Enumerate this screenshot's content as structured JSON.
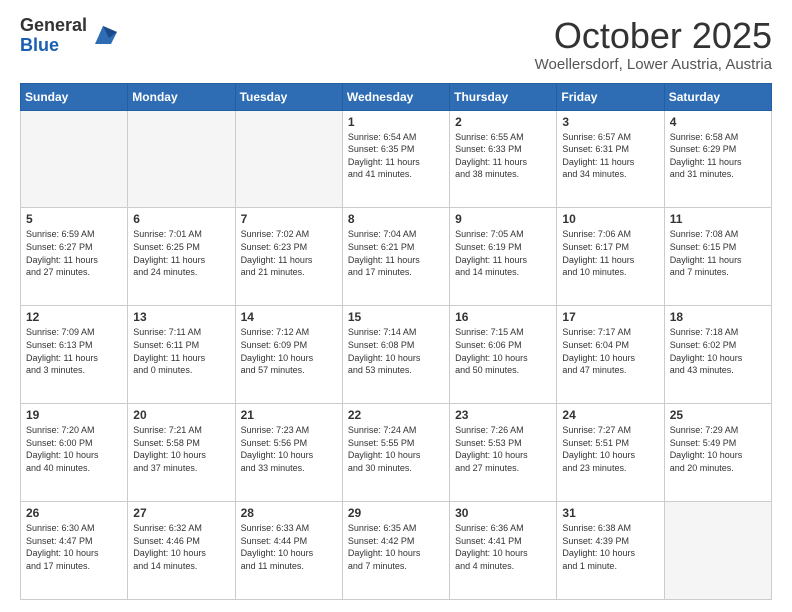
{
  "header": {
    "logo_general": "General",
    "logo_blue": "Blue",
    "month": "October 2025",
    "location": "Woellersdorf, Lower Austria, Austria"
  },
  "weekdays": [
    "Sunday",
    "Monday",
    "Tuesday",
    "Wednesday",
    "Thursday",
    "Friday",
    "Saturday"
  ],
  "weeks": [
    [
      {
        "day": "",
        "info": ""
      },
      {
        "day": "",
        "info": ""
      },
      {
        "day": "",
        "info": ""
      },
      {
        "day": "1",
        "info": "Sunrise: 6:54 AM\nSunset: 6:35 PM\nDaylight: 11 hours\nand 41 minutes."
      },
      {
        "day": "2",
        "info": "Sunrise: 6:55 AM\nSunset: 6:33 PM\nDaylight: 11 hours\nand 38 minutes."
      },
      {
        "day": "3",
        "info": "Sunrise: 6:57 AM\nSunset: 6:31 PM\nDaylight: 11 hours\nand 34 minutes."
      },
      {
        "day": "4",
        "info": "Sunrise: 6:58 AM\nSunset: 6:29 PM\nDaylight: 11 hours\nand 31 minutes."
      }
    ],
    [
      {
        "day": "5",
        "info": "Sunrise: 6:59 AM\nSunset: 6:27 PM\nDaylight: 11 hours\nand 27 minutes."
      },
      {
        "day": "6",
        "info": "Sunrise: 7:01 AM\nSunset: 6:25 PM\nDaylight: 11 hours\nand 24 minutes."
      },
      {
        "day": "7",
        "info": "Sunrise: 7:02 AM\nSunset: 6:23 PM\nDaylight: 11 hours\nand 21 minutes."
      },
      {
        "day": "8",
        "info": "Sunrise: 7:04 AM\nSunset: 6:21 PM\nDaylight: 11 hours\nand 17 minutes."
      },
      {
        "day": "9",
        "info": "Sunrise: 7:05 AM\nSunset: 6:19 PM\nDaylight: 11 hours\nand 14 minutes."
      },
      {
        "day": "10",
        "info": "Sunrise: 7:06 AM\nSunset: 6:17 PM\nDaylight: 11 hours\nand 10 minutes."
      },
      {
        "day": "11",
        "info": "Sunrise: 7:08 AM\nSunset: 6:15 PM\nDaylight: 11 hours\nand 7 minutes."
      }
    ],
    [
      {
        "day": "12",
        "info": "Sunrise: 7:09 AM\nSunset: 6:13 PM\nDaylight: 11 hours\nand 3 minutes."
      },
      {
        "day": "13",
        "info": "Sunrise: 7:11 AM\nSunset: 6:11 PM\nDaylight: 11 hours\nand 0 minutes."
      },
      {
        "day": "14",
        "info": "Sunrise: 7:12 AM\nSunset: 6:09 PM\nDaylight: 10 hours\nand 57 minutes."
      },
      {
        "day": "15",
        "info": "Sunrise: 7:14 AM\nSunset: 6:08 PM\nDaylight: 10 hours\nand 53 minutes."
      },
      {
        "day": "16",
        "info": "Sunrise: 7:15 AM\nSunset: 6:06 PM\nDaylight: 10 hours\nand 50 minutes."
      },
      {
        "day": "17",
        "info": "Sunrise: 7:17 AM\nSunset: 6:04 PM\nDaylight: 10 hours\nand 47 minutes."
      },
      {
        "day": "18",
        "info": "Sunrise: 7:18 AM\nSunset: 6:02 PM\nDaylight: 10 hours\nand 43 minutes."
      }
    ],
    [
      {
        "day": "19",
        "info": "Sunrise: 7:20 AM\nSunset: 6:00 PM\nDaylight: 10 hours\nand 40 minutes."
      },
      {
        "day": "20",
        "info": "Sunrise: 7:21 AM\nSunset: 5:58 PM\nDaylight: 10 hours\nand 37 minutes."
      },
      {
        "day": "21",
        "info": "Sunrise: 7:23 AM\nSunset: 5:56 PM\nDaylight: 10 hours\nand 33 minutes."
      },
      {
        "day": "22",
        "info": "Sunrise: 7:24 AM\nSunset: 5:55 PM\nDaylight: 10 hours\nand 30 minutes."
      },
      {
        "day": "23",
        "info": "Sunrise: 7:26 AM\nSunset: 5:53 PM\nDaylight: 10 hours\nand 27 minutes."
      },
      {
        "day": "24",
        "info": "Sunrise: 7:27 AM\nSunset: 5:51 PM\nDaylight: 10 hours\nand 23 minutes."
      },
      {
        "day": "25",
        "info": "Sunrise: 7:29 AM\nSunset: 5:49 PM\nDaylight: 10 hours\nand 20 minutes."
      }
    ],
    [
      {
        "day": "26",
        "info": "Sunrise: 6:30 AM\nSunset: 4:47 PM\nDaylight: 10 hours\nand 17 minutes."
      },
      {
        "day": "27",
        "info": "Sunrise: 6:32 AM\nSunset: 4:46 PM\nDaylight: 10 hours\nand 14 minutes."
      },
      {
        "day": "28",
        "info": "Sunrise: 6:33 AM\nSunset: 4:44 PM\nDaylight: 10 hours\nand 11 minutes."
      },
      {
        "day": "29",
        "info": "Sunrise: 6:35 AM\nSunset: 4:42 PM\nDaylight: 10 hours\nand 7 minutes."
      },
      {
        "day": "30",
        "info": "Sunrise: 6:36 AM\nSunset: 4:41 PM\nDaylight: 10 hours\nand 4 minutes."
      },
      {
        "day": "31",
        "info": "Sunrise: 6:38 AM\nSunset: 4:39 PM\nDaylight: 10 hours\nand 1 minute."
      },
      {
        "day": "",
        "info": ""
      }
    ]
  ]
}
